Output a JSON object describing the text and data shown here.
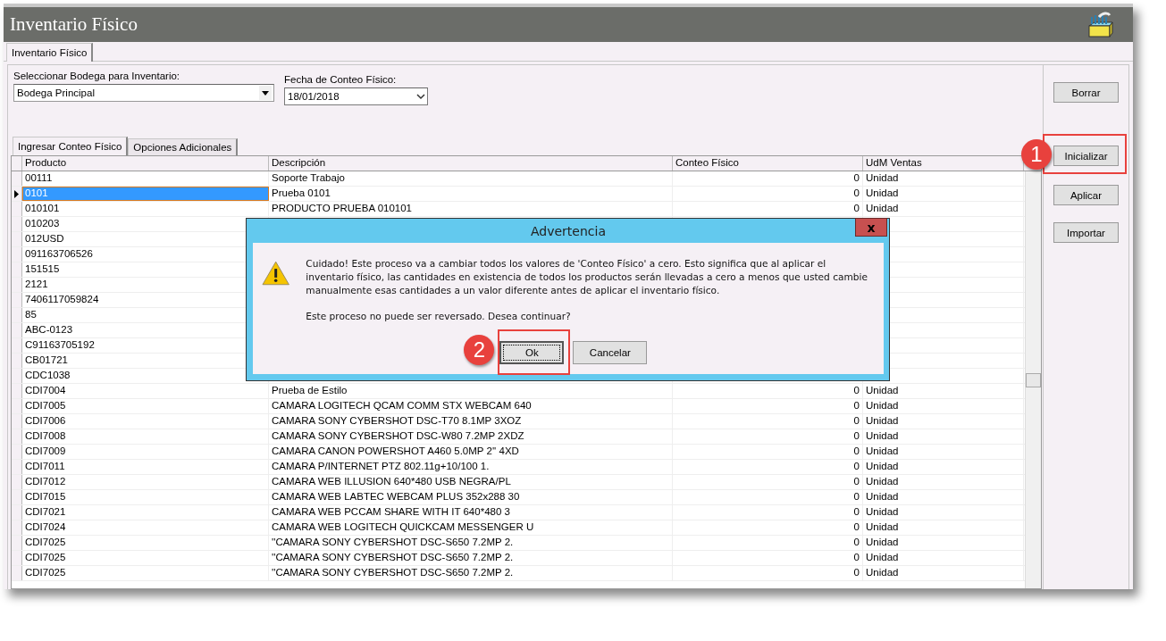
{
  "window": {
    "title": "Inventario Físico"
  },
  "outer_tabs": [
    {
      "label": "Inventario Físico",
      "selected": true
    }
  ],
  "fields": [
    {
      "label": "Seleccionar Bodega para Inventario:",
      "value": "Bodega Principal",
      "kind": "combo"
    },
    {
      "label": "Fecha de Conteo Físico:",
      "value": "18/01/2018",
      "kind": "date"
    }
  ],
  "inner_tabs": [
    {
      "label": "Ingresar Conteo Físico",
      "selected": true
    },
    {
      "label": "Opciones Adicionales",
      "selected": false
    }
  ],
  "table": {
    "columns": [
      "Producto",
      "Descripción",
      "Conteo Físico",
      "UdM Ventas"
    ],
    "rows": [
      {
        "producto": "00111",
        "descripcion": "Soporte Trabajo",
        "conteo": "0",
        "udm": "Unidad",
        "selected": false
      },
      {
        "producto": "0101",
        "descripcion": "Prueba 0101",
        "conteo": "0",
        "udm": "Unidad",
        "selected": true
      },
      {
        "producto": "010101",
        "descripcion": "PRODUCTO PRUEBA 010101",
        "conteo": "0",
        "udm": "Unidad",
        "selected": false
      },
      {
        "producto": "010203",
        "selected": false
      },
      {
        "producto": "012USD",
        "selected": false
      },
      {
        "producto": "091163706526",
        "selected": false
      },
      {
        "producto": "151515",
        "selected": false
      },
      {
        "producto": "2121",
        "selected": false
      },
      {
        "producto": "7406117059824",
        "selected": false
      },
      {
        "producto": "85",
        "selected": false
      },
      {
        "producto": "ABC-0123",
        "selected": false
      },
      {
        "producto": "C91163705192",
        "selected": false
      },
      {
        "producto": "CB01721",
        "selected": false
      },
      {
        "producto": "CDC1038",
        "selected": false
      },
      {
        "producto": "CDI7004",
        "descripcion": "Prueba de Estilo",
        "conteo": "0",
        "udm": "Unidad",
        "selected": false
      },
      {
        "producto": "CDI7005",
        "descripcion": "CAMARA LOGITECH QCAM COMM STX WEBCAM 640",
        "conteo": "0",
        "udm": "Unidad",
        "selected": false
      },
      {
        "producto": "CDI7006",
        "descripcion": "CAMARA SONY CYBERSHOT DSC-T70 8.1MP 3XOZ",
        "conteo": "0",
        "udm": "Unidad",
        "selected": false
      },
      {
        "producto": "CDI7008",
        "descripcion": "CAMARA SONY CYBERSHOT DSC-W80 7.2MP 2XDZ",
        "conteo": "0",
        "udm": "Unidad",
        "selected": false
      },
      {
        "producto": "CDI7009",
        "descripcion": "CAMARA CANON POWERSHOT A460 5.0MP 2'' 4XD",
        "conteo": "0",
        "udm": "Unidad",
        "selected": false
      },
      {
        "producto": "CDI7011",
        "descripcion": "CAMARA P/INTERNET PTZ  802.11g+10/100 1.",
        "conteo": "0",
        "udm": "Unidad",
        "selected": false
      },
      {
        "producto": "CDI7012",
        "descripcion": "CAMARA WEB ILLUSION 640*480 USB NEGRA/PL",
        "conteo": "0",
        "udm": "Unidad",
        "selected": false
      },
      {
        "producto": "CDI7015",
        "descripcion": "CAMARA WEB LABTEC WEBCAM PLUS 352x288 30",
        "conteo": "0",
        "udm": "Unidad",
        "selected": false
      },
      {
        "producto": "CDI7021",
        "descripcion": "CAMARA WEB PCCAM SHARE WITH IT 640*480 3",
        "conteo": "0",
        "udm": "Unidad",
        "selected": false
      },
      {
        "producto": "CDI7024",
        "descripcion": "CAMARA WEB LOGITECH QUICKCAM MESSENGER U",
        "conteo": "0",
        "udm": "Unidad",
        "selected": false
      },
      {
        "producto": "CDI7025",
        "descripcion": "''CAMARA SONY CYBERSHOT DSC-S650 7.2MP 2.",
        "conteo": "0",
        "udm": "Unidad",
        "selected": false
      },
      {
        "producto": "CDI7025",
        "descripcion": "''CAMARA SONY CYBERSHOT DSC-S650 7.2MP 2.",
        "conteo": "0",
        "udm": "Unidad",
        "selected": false
      },
      {
        "producto": "CDI7025",
        "descripcion": "''CAMARA SONY CYBERSHOT DSC-S650 7.2MP 2.",
        "conteo": "0",
        "udm": "Unidad",
        "selected": false
      }
    ]
  },
  "side_buttons": [
    {
      "label": "Borrar"
    },
    {
      "label": "Inicializar",
      "annotation": "1"
    },
    {
      "label": "Aplicar"
    },
    {
      "label": "Importar"
    }
  ],
  "dialog": {
    "title": "Advertencia",
    "close": "x",
    "message": "Cuidado!  Este proceso va a cambiar todos los valores de 'Conteo Físico' a cero.  Esto significa que al aplicar el inventario físico, las cantidades en existencia de todos los productos serán llevadas a cero a menos que usted cambie manualmente esas cantidades a un valor diferente antes de aplicar el inventario físico.",
    "question": "Este proceso no puede ser reversado.  Desea continuar?",
    "buttons": [
      {
        "label": "Ok",
        "selected": true,
        "annotation": "2"
      },
      {
        "label": "Cancelar",
        "selected": false
      }
    ]
  }
}
